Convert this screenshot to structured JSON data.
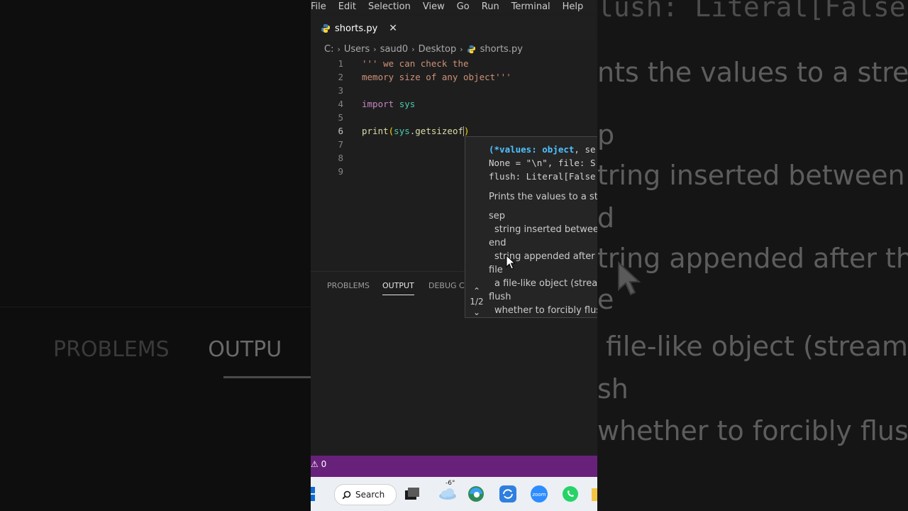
{
  "menu": [
    "File",
    "Edit",
    "Selection",
    "View",
    "Go",
    "Run",
    "Terminal",
    "Help"
  ],
  "tab": {
    "filename": "shorts.py",
    "close": "✕"
  },
  "breadcrumb": [
    "C:",
    "Users",
    "saud0",
    "Desktop",
    "shorts.py"
  ],
  "editor": {
    "current_line": 6,
    "lines": [
      {
        "n": "1",
        "tokens": [
          {
            "t": "''' we can check the",
            "c": "c-str"
          }
        ]
      },
      {
        "n": "2",
        "tokens": [
          {
            "t": "memory size of any object'''",
            "c": "c-str"
          }
        ]
      },
      {
        "n": "3",
        "tokens": []
      },
      {
        "n": "4",
        "tokens": [
          {
            "t": "import",
            "c": "c-kw"
          },
          {
            "t": " ",
            "c": "c-def"
          },
          {
            "t": "sys",
            "c": "c-mod"
          }
        ]
      },
      {
        "n": "5",
        "tokens": []
      },
      {
        "n": "6",
        "tokens": [
          {
            "t": "print",
            "c": "c-fn"
          },
          {
            "t": "(",
            "c": "c-par"
          },
          {
            "t": "sys",
            "c": "c-mod"
          },
          {
            "t": ".",
            "c": "c-def"
          },
          {
            "t": "getsizeof",
            "c": "c-fn"
          }
        ]
      },
      {
        "n": "7",
        "tokens": []
      },
      {
        "n": "8",
        "tokens": []
      },
      {
        "n": "9",
        "tokens": []
      }
    ],
    "line6_tail": ")"
  },
  "hover": {
    "sig_line1_a": "(*values: object",
    "sig_line1_b": ", se",
    "sig_line2": "None = \"\\n\", file: S",
    "sig_line3": "flush: Literal[False",
    "description": "Prints the values to a stre",
    "params": [
      {
        "name": "sep",
        "desc": "string inserted between"
      },
      {
        "name": "end",
        "desc": "string appended after th"
      },
      {
        "name": "file",
        "desc": "a file-like object (stream"
      },
      {
        "name": "flush",
        "desc": "whether to forcibly flush"
      }
    ],
    "pager_up": "⌃",
    "pager_count": "1/2",
    "pager_down": "⌄"
  },
  "panel_tabs": [
    "PROBLEMS",
    "OUTPUT",
    "DEBUG CO"
  ],
  "active_panel_tab": "OUTPUT",
  "status": {
    "warnings": "0"
  },
  "taskbar": {
    "search_label": "Search",
    "weather": "-6°"
  },
  "background": {
    "left": {
      "tabs": [
        "PROBLEMS",
        "OUTPU"
      ]
    },
    "right": {
      "lines": [
        "lush:  Literal[False",
        "nts the values to a stre",
        "p",
        "tring inserted between",
        "d",
        "tring appended after th",
        "e",
        "file-like object (stream",
        "sh",
        "whether to forcibly flush"
      ]
    }
  },
  "colors": {
    "status_bar": "#68217a",
    "editor_bg": "#1e1e1e",
    "taskbar_bg": "#eceff4"
  }
}
